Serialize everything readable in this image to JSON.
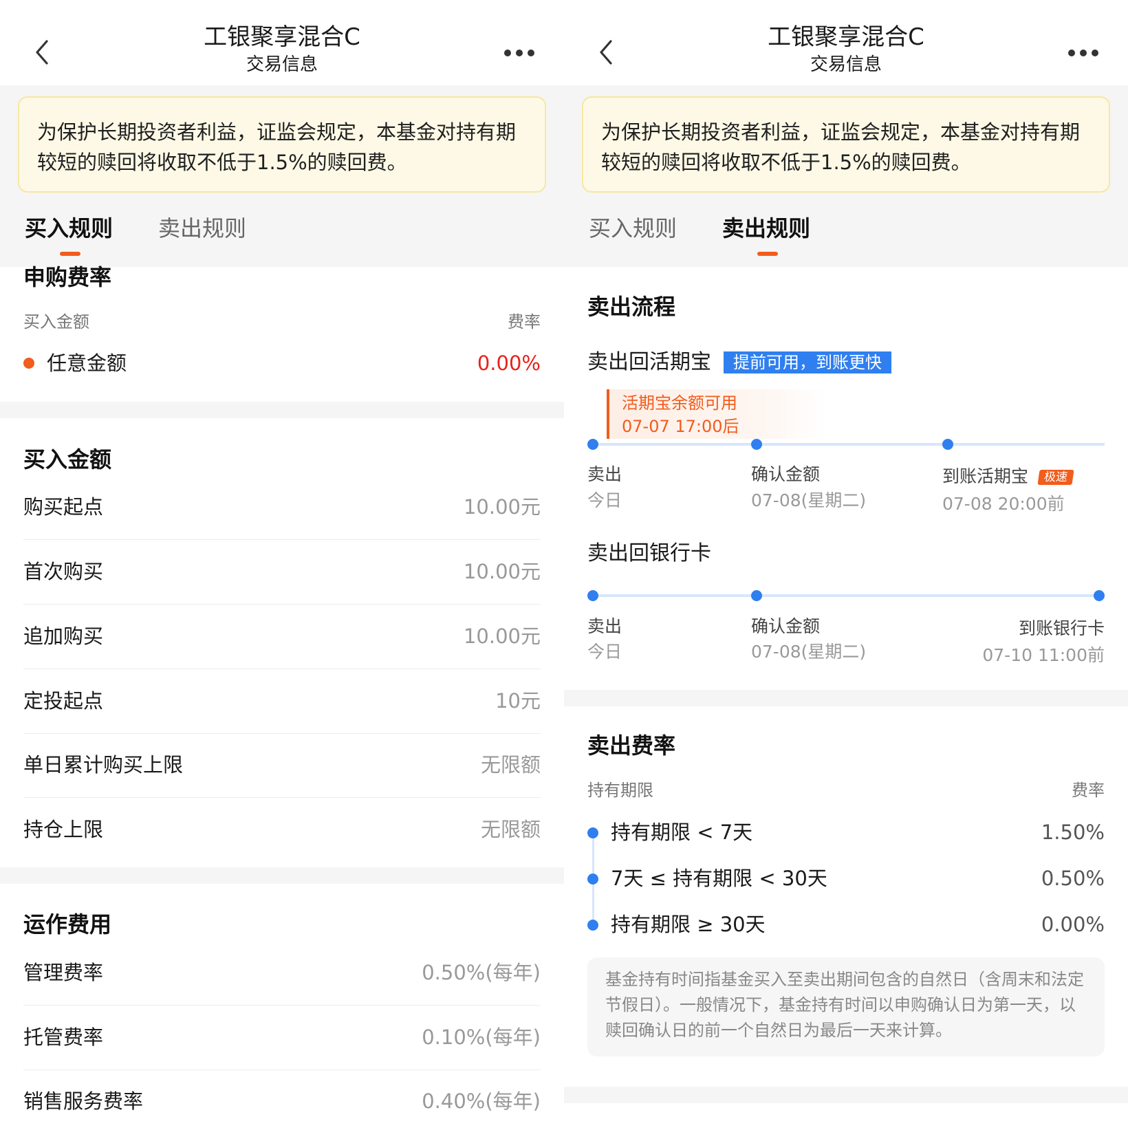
{
  "header": {
    "title": "工银聚享混合C",
    "subtitle": "交易信息",
    "back_icon": "chevron-left-icon",
    "more_icon": "more-dots-icon"
  },
  "notice": "为保护长期投资者利益，证监会规定，本基金对持有期较短的赎回将收取不低于1.5%的赎回费。",
  "tabs": {
    "buy": "买入规则",
    "sell": "卖出规则"
  },
  "buy_rules": {
    "purchase_fee": {
      "title": "申购费率",
      "col_amount": "买入金额",
      "col_rate": "费率",
      "row_label": "任意金额",
      "row_value": "0.00%"
    },
    "buy_amount": {
      "title": "买入金额",
      "rows": [
        {
          "label": "购买起点",
          "value": "10.00元"
        },
        {
          "label": "首次购买",
          "value": "10.00元"
        },
        {
          "label": "追加购买",
          "value": "10.00元"
        },
        {
          "label": "定投起点",
          "value": "10元"
        },
        {
          "label": "单日累计购买上限",
          "value": "无限额"
        },
        {
          "label": "持仓上限",
          "value": "无限额"
        }
      ]
    },
    "operating_fees": {
      "title": "运作费用",
      "rows": [
        {
          "label": "管理费率",
          "value": "0.50%(每年)"
        },
        {
          "label": "托管费率",
          "value": "0.10%(每年)"
        },
        {
          "label": "销售服务费率",
          "value": "0.40%(每年)"
        }
      ]
    }
  },
  "sell_rules": {
    "process_title": "卖出流程",
    "to_huoqibao": {
      "title": "卖出回活期宝",
      "badge": "提前可用，到账更快",
      "callout_line1": "活期宝余额可用",
      "callout_line2": "07-07 17:00后",
      "steps": [
        {
          "label": "卖出",
          "sub": "今日"
        },
        {
          "label": "确认金额",
          "sub": "07-08(星期二)"
        },
        {
          "label": "到账活期宝",
          "sub": "07-08 20:00前",
          "tag": "极速"
        }
      ]
    },
    "to_bank": {
      "title": "卖出回银行卡",
      "steps": [
        {
          "label": "卖出",
          "sub": "今日"
        },
        {
          "label": "确认金额",
          "sub": "07-08(星期二)"
        },
        {
          "label": "到账银行卡",
          "sub": "07-10 11:00前"
        }
      ]
    },
    "sell_fee": {
      "title": "卖出费率",
      "col_period": "持有期限",
      "col_rate": "费率",
      "rows": [
        {
          "label": "持有期限 < 7天",
          "value": "1.50%"
        },
        {
          "label": "7天 ≤ 持有期限 < 30天",
          "value": "0.50%"
        },
        {
          "label": "持有期限 ≥ 30天",
          "value": "0.00%"
        }
      ]
    },
    "note": "基金持有时间指基金买入至卖出期间包含的自然日（含周末和法定节假日）。一般情况下，基金持有时间以申购确认日为第一天，以赎回确认日的前一个自然日为最后一天来计算。"
  },
  "colors": {
    "accent_orange": "#f25c1c",
    "accent_blue": "#2f7ff0",
    "notice_bg": "#fdf9e6",
    "value_red": "#e8221a"
  }
}
